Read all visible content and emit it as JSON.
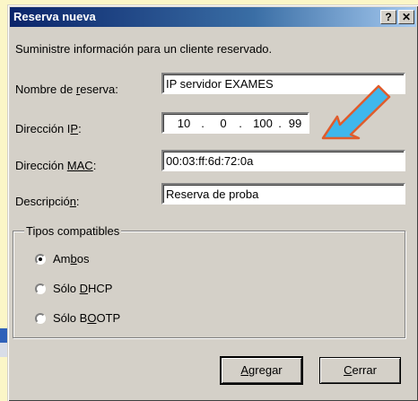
{
  "dialog": {
    "title": "Reserva nueva",
    "help_label": "?",
    "close_label": "✕",
    "intro": "Suministre información para un cliente reservado."
  },
  "fields": {
    "name": {
      "label_pre": "Nombre de ",
      "label_u": "r",
      "label_post": "eserva:",
      "value": "IP servidor EXAMES"
    },
    "ip": {
      "label_pre": "Dirección I",
      "label_u": "P",
      "label_post": ":",
      "octets": [
        "10",
        "0",
        "100",
        "99"
      ],
      "sep": "."
    },
    "mac": {
      "label_pre": "Dirección ",
      "label_u": "MAC",
      "label_post": ":",
      "value": "00:03:ff:6d:72:0a"
    },
    "desc": {
      "label_pre": "Descripció",
      "label_u": "n",
      "label_post": ":",
      "value": "Reserva de proba"
    }
  },
  "types": {
    "legend": "Tipos compatibles",
    "options": [
      {
        "pre": "Am",
        "u": "b",
        "post": "os",
        "checked": true
      },
      {
        "pre": "Sólo ",
        "u": "D",
        "post": "HCP",
        "checked": false
      },
      {
        "pre": "Sólo B",
        "u": "O",
        "post": "OTP",
        "checked": false
      }
    ]
  },
  "buttons": {
    "add": {
      "pre": "",
      "u": "A",
      "post": "gregar"
    },
    "close": {
      "pre": "",
      "u": "C",
      "post": "errar"
    }
  },
  "colors": {
    "arrow_fill": "#3fb7ec",
    "arrow_stroke": "#e05c2c",
    "title_start": "#0a246a"
  },
  "icons": {
    "annotation": "arrow-annotation-icon",
    "radio_checked": "radio-checked-icon"
  }
}
